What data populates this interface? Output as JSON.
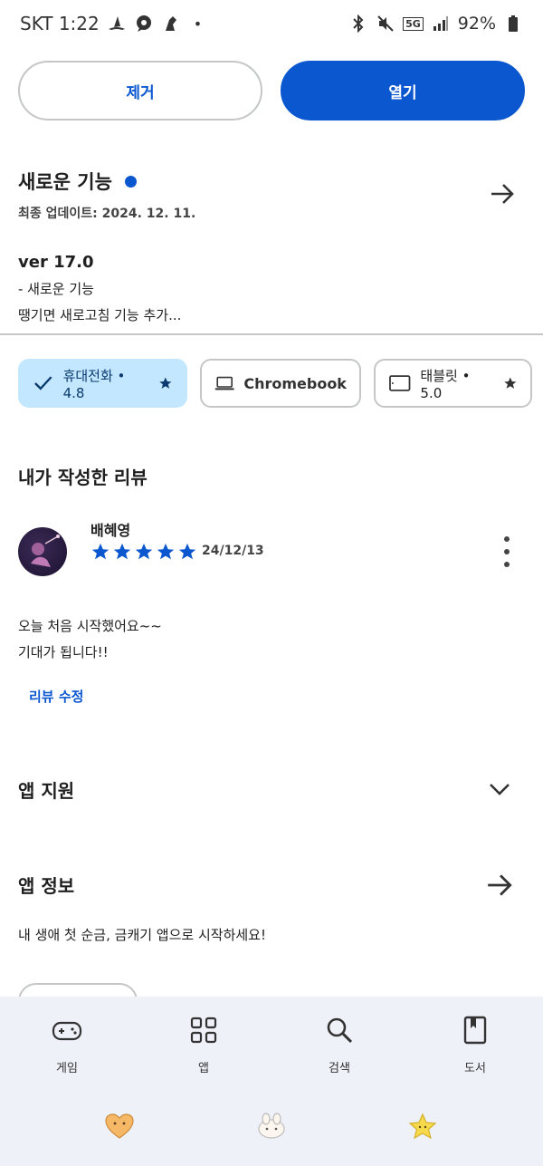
{
  "status_bar": {
    "carrier_time": "SKT 1:22",
    "dot": "•",
    "network": "5G",
    "battery": "92%"
  },
  "actions": {
    "uninstall_label": "제거",
    "open_label": "열기"
  },
  "whats_new": {
    "title": "새로운 기능",
    "updated": "최종 업데이트: 2024. 12. 11.",
    "version": "ver 17.0",
    "line1": "- 새로운 기능",
    "line2": "땡기면 새로고침 기능 추가..."
  },
  "devices": {
    "phone_label": "휴대전화 • 4.8",
    "chromebook_label": "Chromebook",
    "tablet_label": "태블릿 • 5.0"
  },
  "my_review": {
    "section_title": "내가 작성한 리뷰",
    "reviewer": "배혜영",
    "rating": 5,
    "date": "24/12/13",
    "text_line1": "오늘 처음 시작했어요~~",
    "text_line2": "기대가 됩니다!!",
    "edit_label": "리뷰 수정"
  },
  "app_support": {
    "title": "앱 지원"
  },
  "app_info": {
    "title": "앱 정보",
    "description": "내 생애 첫 순금, 금캐기 앱으로 시작하세요!"
  },
  "bottom_nav": {
    "items": [
      {
        "label": "게임",
        "icon": "gamepad-icon"
      },
      {
        "label": "앱",
        "icon": "apps-grid-icon"
      },
      {
        "label": "검색",
        "icon": "search-icon"
      },
      {
        "label": "도서",
        "icon": "book-icon"
      }
    ]
  },
  "colors": {
    "accent": "#0b57d0",
    "chip_selected": "#c2e7ff",
    "nav_bg": "#eef1f8",
    "star": "#0b57d0"
  }
}
